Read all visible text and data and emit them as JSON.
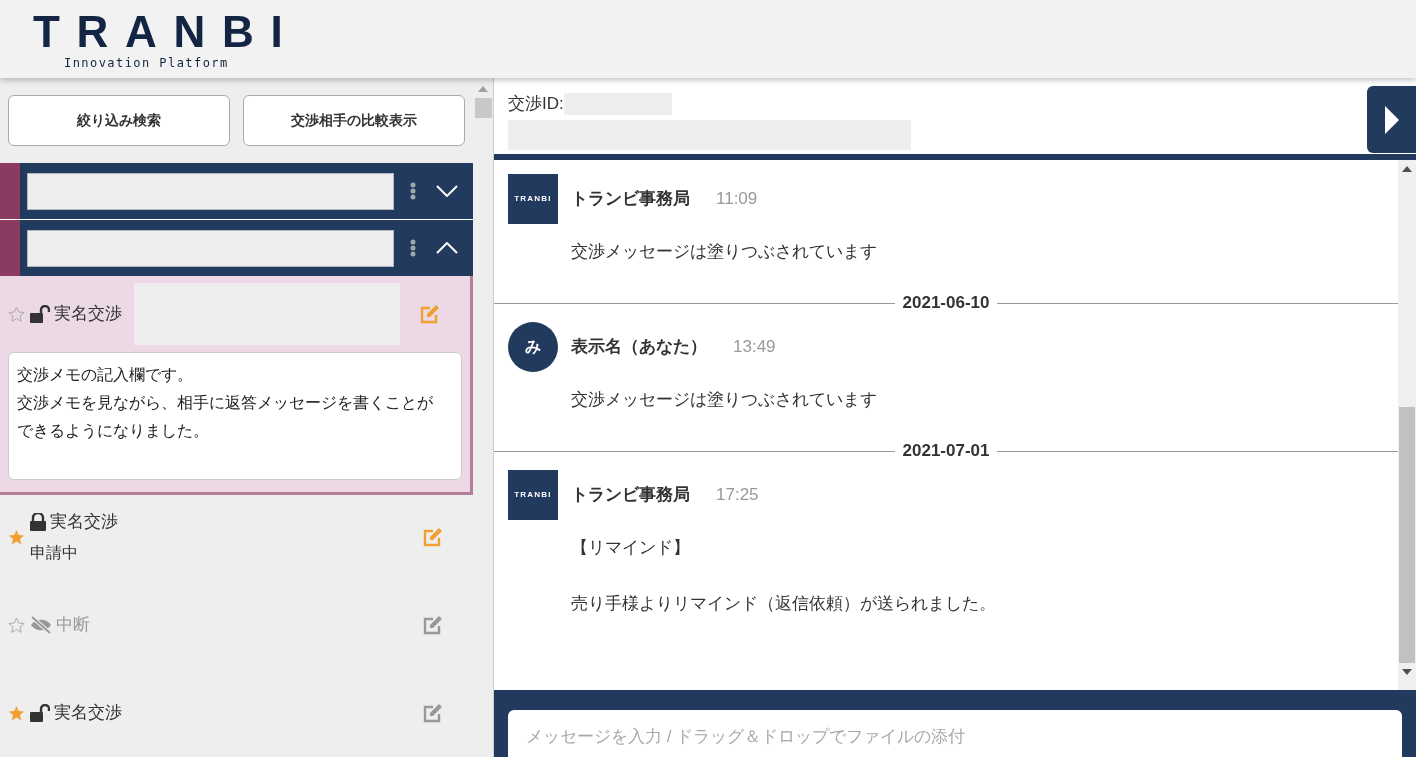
{
  "header": {
    "logo": "TRANBI",
    "tagline": "Innovation Platform"
  },
  "left_buttons": [
    "絞り込み検索",
    "交渉相手の比較表示"
  ],
  "groups": [
    {
      "expanded": false
    },
    {
      "expanded": true
    }
  ],
  "negotiations": [
    {
      "starred": false,
      "kind": "unlocked",
      "label": "実名交渉",
      "active": true,
      "selected": true,
      "memo": [
        "交渉メモの記入欄です。",
        "交渉メモを見ながら、相手に返答メッセージを書くことができるようになりました。"
      ]
    },
    {
      "starred": true,
      "kind": "locked",
      "label": "実名交渉",
      "status": "申請中",
      "active": true,
      "selected": false
    },
    {
      "starred": false,
      "kind": "hidden",
      "label": "中断",
      "active": false,
      "selected": false
    },
    {
      "starred": true,
      "kind": "unlocked",
      "label": "実名交渉",
      "active": false,
      "selected": false
    }
  ],
  "chat": {
    "id_label": "交渉ID:",
    "items": [
      {
        "kind": "message",
        "avatar": {
          "kind": "logo",
          "text": "TRANBI"
        },
        "sender": "トランビ事務局",
        "time": "11:09",
        "paragraphs": [
          "交渉メッセージは塗りつぶされています"
        ]
      },
      {
        "kind": "date",
        "text": "2021-06-10"
      },
      {
        "kind": "message",
        "avatar": {
          "kind": "initial",
          "text": "み"
        },
        "sender": "表示名（あなた）",
        "time": "13:49",
        "paragraphs": [
          "交渉メッセージは塗りつぶされています"
        ]
      },
      {
        "kind": "date",
        "text": "2021-07-01"
      },
      {
        "kind": "message",
        "avatar": {
          "kind": "logo",
          "text": "TRANBI"
        },
        "sender": "トランビ事務局",
        "time": "17:25",
        "paragraphs": [
          "【リマインド】",
          "売り手様よりリマインド（返信依頼）が送られました。"
        ]
      }
    ],
    "composer": {
      "placeholder": "メッセージを入力 / ドラッグ＆ドロップでファイルの添付"
    }
  }
}
